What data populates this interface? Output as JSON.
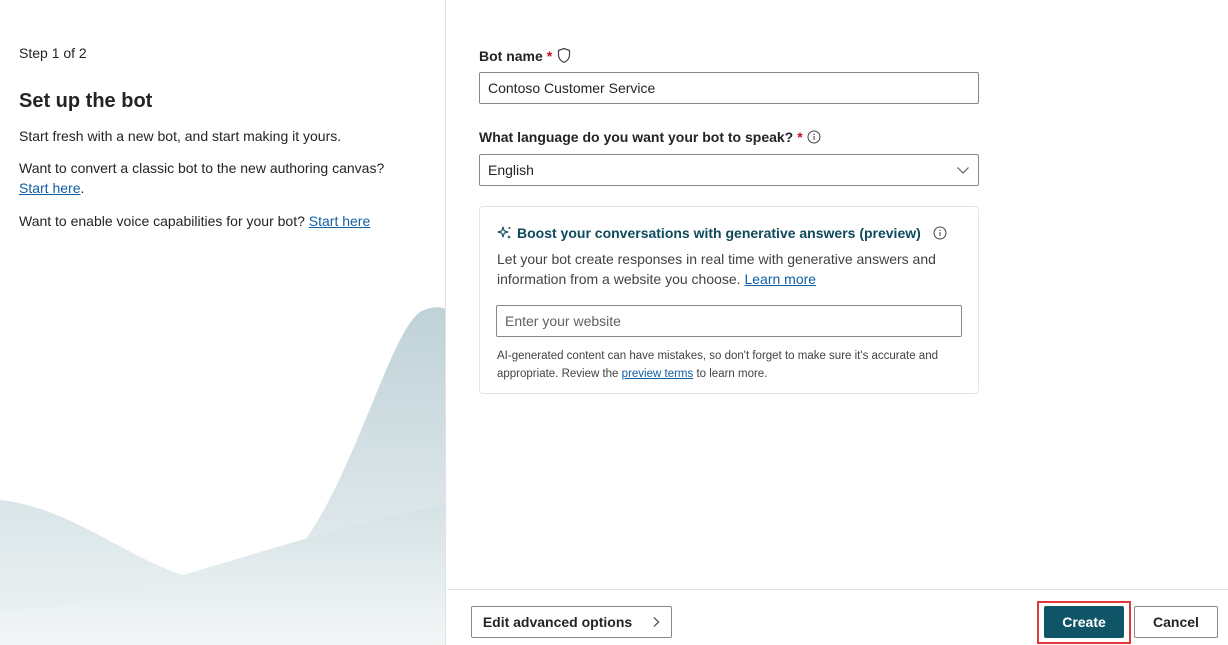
{
  "left": {
    "step": "Step 1 of 2",
    "title": "Set up the bot",
    "intro": "Start fresh with a new bot, and start making it yours.",
    "convert_text": "Want to convert a classic bot to the new authoring canvas?",
    "convert_link": "Start here",
    "convert_period": ".",
    "voice_text": "Want to enable voice capabilities for your bot?",
    "voice_link": "Start here"
  },
  "form": {
    "bot_name_label": "Bot name",
    "required_mark": "*",
    "bot_name_value": "Contoso Customer Service",
    "language_label": "What language do you want your bot to speak?",
    "language_value": "English"
  },
  "generative": {
    "title": "Boost your conversations with generative answers (preview)",
    "body": "Let your bot create responses in real time with generative answers and information from a website you choose.",
    "learn_more": "Learn more",
    "website_placeholder": "Enter your website",
    "disclaimer_pre": "AI-generated content can have mistakes, so don't forget to make sure it's accurate and appropriate. Review the",
    "disclaimer_link": "preview terms",
    "disclaimer_post": "to learn more."
  },
  "footer": {
    "advanced_label": "Edit advanced options",
    "create_label": "Create",
    "cancel_label": "Cancel"
  },
  "colors": {
    "primary": "#0f5567",
    "link": "#115ea3",
    "required": "#c50f1f",
    "highlight": "#e0383e",
    "wave": "#c9d9de"
  },
  "icons": {
    "shield": "shield-icon",
    "info": "info-icon",
    "chevron_down": "chevron-down-icon",
    "sparkle": "sparkle-icon",
    "chevron_right": "chevron-right-icon"
  }
}
